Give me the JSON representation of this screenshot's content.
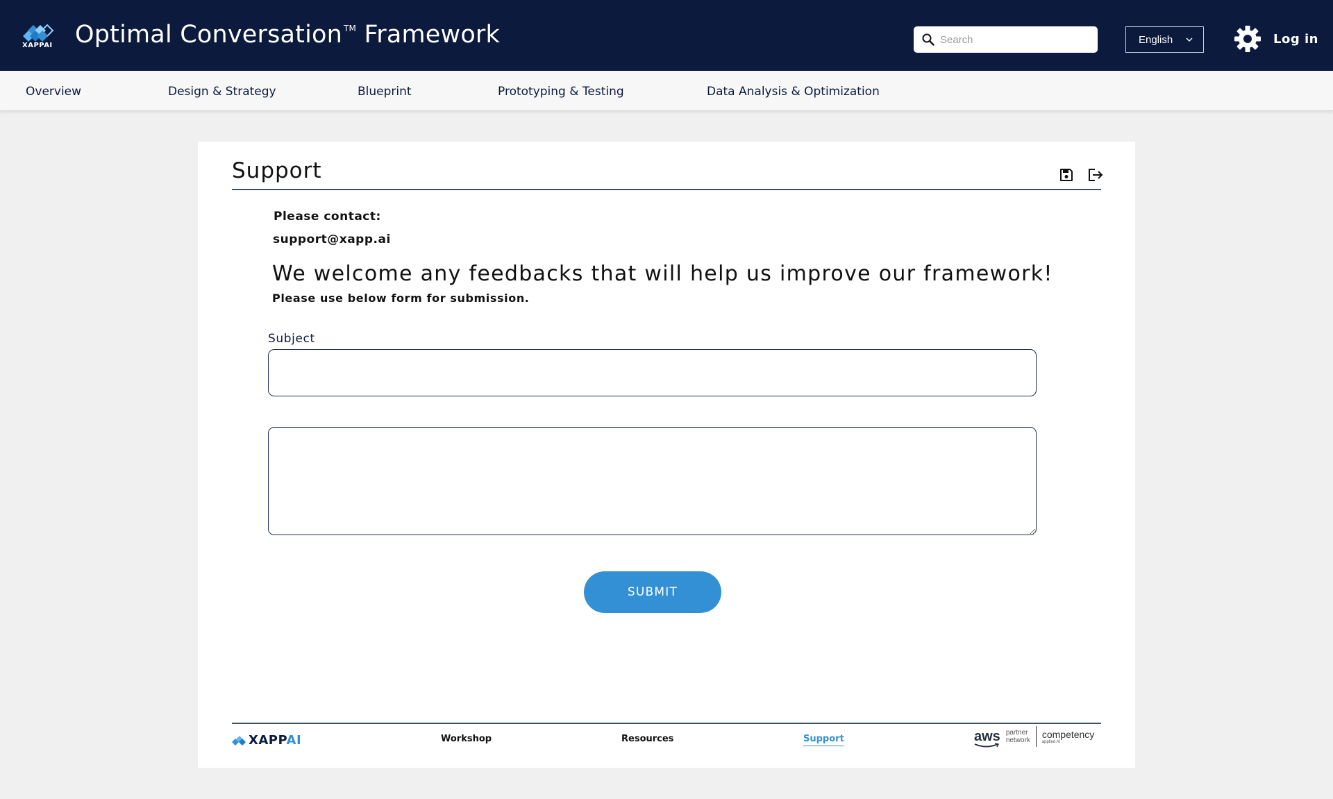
{
  "header": {
    "logo_text": "XAPPAI",
    "title": "Optimal Conversation",
    "title_tm": "TM",
    "title_suffix": "Framework",
    "search_placeholder": "Search",
    "language": "English",
    "login_label": "Log in"
  },
  "nav": {
    "items": [
      {
        "label": "Overview"
      },
      {
        "label": "Design & Strategy"
      },
      {
        "label": "Blueprint"
      },
      {
        "label": "Prototyping & Testing"
      },
      {
        "label": "Data Analysis & Optimization"
      }
    ]
  },
  "main": {
    "title": "Support",
    "contact_label": "Please contact:",
    "contact_email": "support@xapp.ai",
    "welcome": "We welcome any feedbacks that will help us improve our framework!",
    "note": "Please use below form for submission.",
    "subject_label": "Subject",
    "subject_value": "",
    "message_value": "",
    "submit_label": "SUBMIT"
  },
  "footer": {
    "logo_main": "XAPP",
    "logo_ai": "AI",
    "links": [
      {
        "label": "Workshop"
      },
      {
        "label": "Resources"
      },
      {
        "label": "Support",
        "active": true
      }
    ],
    "aws_word": "aws",
    "aws_partner_1": "partner",
    "aws_partner_2": "network",
    "aws_competency": "competency",
    "aws_competency_sub": "applied AI"
  },
  "colors": {
    "header_bg": "#0b1a3d",
    "accent": "#3390d4",
    "page_bg": "#f0f0f0"
  },
  "icons": {
    "search": "search-icon",
    "chevron": "chevron-down-icon",
    "settings": "gear-icon",
    "save": "save-icon",
    "exit": "exit-icon"
  }
}
